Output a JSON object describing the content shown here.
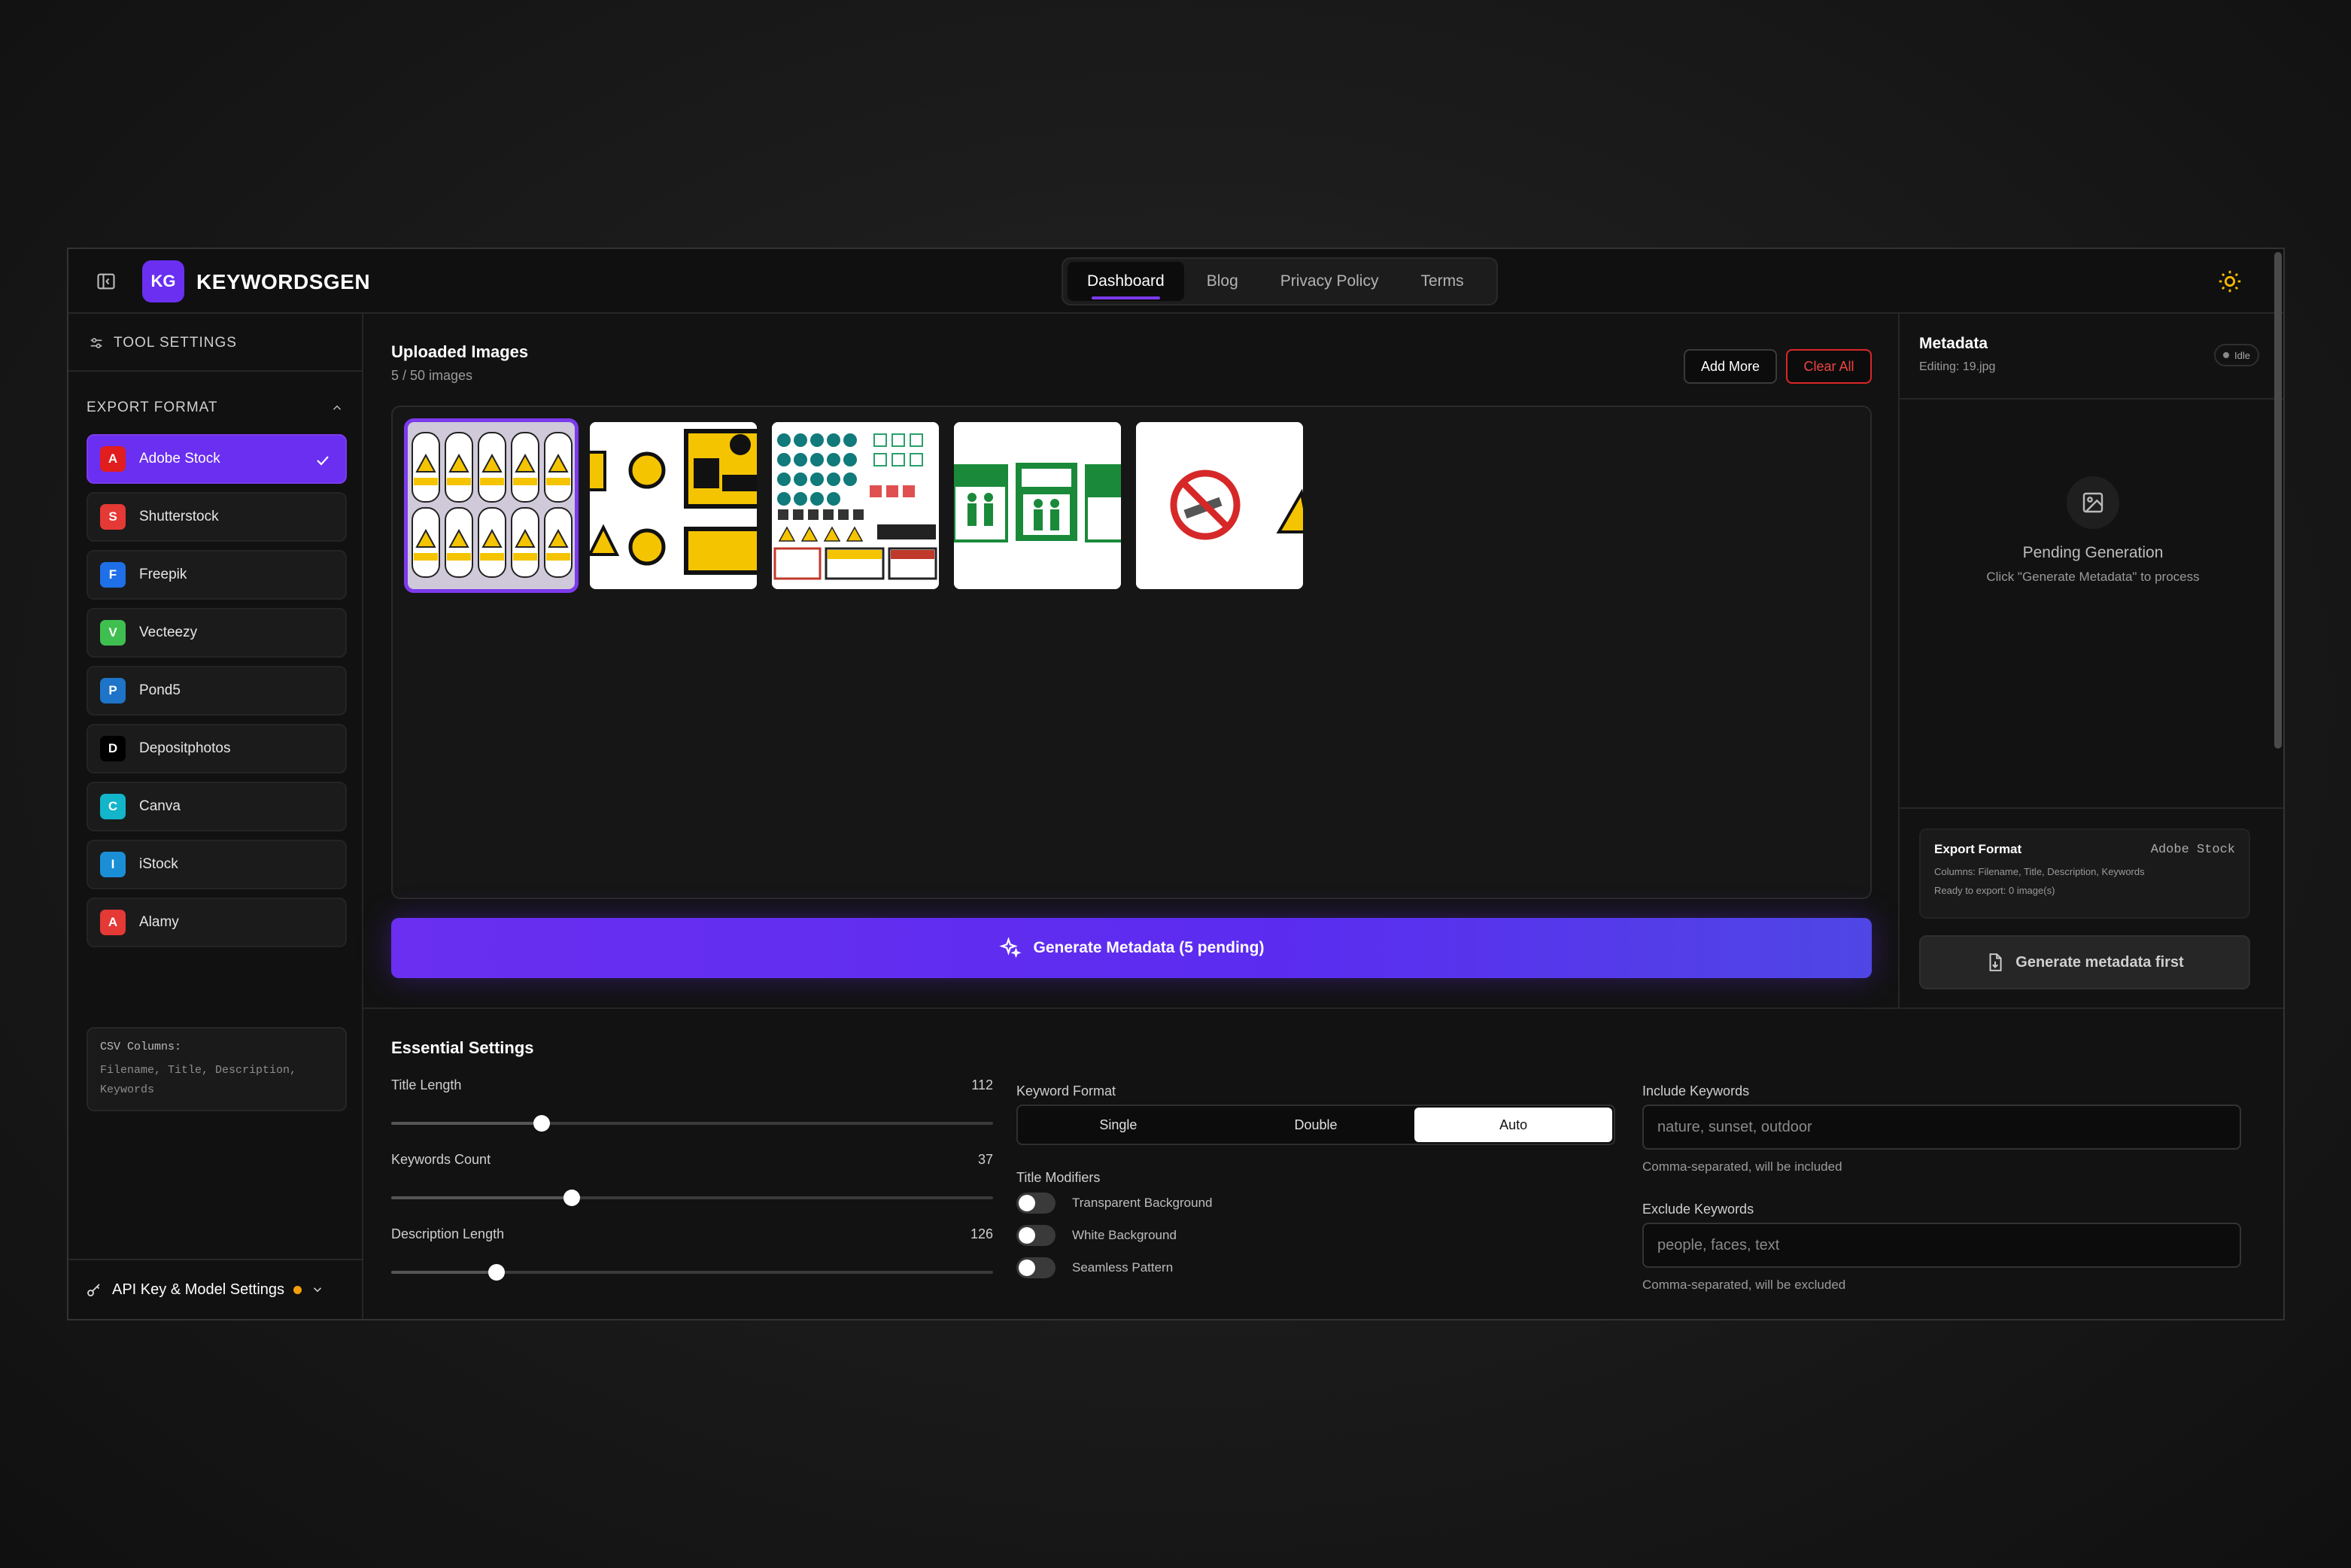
{
  "app": {
    "logo_initials": "KG",
    "logo_text": "KEYWORDSGEN"
  },
  "nav": {
    "tabs": [
      "Dashboard",
      "Blog",
      "Privacy Policy",
      "Terms"
    ],
    "active": "Dashboard"
  },
  "sidebar": {
    "title": "TOOL SETTINGS",
    "export_format_label": "EXPORT FORMAT",
    "platforms": [
      {
        "letter": "A",
        "label": "Adobe Stock",
        "color": "#e11d1d",
        "active": true
      },
      {
        "letter": "S",
        "label": "Shutterstock",
        "color": "#e53935"
      },
      {
        "letter": "F",
        "label": "Freepik",
        "color": "#1e6fe8"
      },
      {
        "letter": "V",
        "label": "Vecteezy",
        "color": "#3fbf4f"
      },
      {
        "letter": "P",
        "label": "Pond5",
        "color": "#1e74c8"
      },
      {
        "letter": "D",
        "label": "Depositphotos",
        "color": "#000000"
      },
      {
        "letter": "C",
        "label": "Canva",
        "color": "#12b5c9"
      },
      {
        "letter": "I",
        "label": "iStock",
        "color": "#1a8fd6"
      },
      {
        "letter": "A",
        "label": "Alamy",
        "color": "#e53935"
      }
    ],
    "csv_title": "CSV Columns:",
    "csv_columns": "Filename, Title, Description, Keywords",
    "api_label": "API Key & Model Settings"
  },
  "upload": {
    "title": "Uploaded Images",
    "count": "5 / 50 images",
    "add_more": "Add More",
    "clear_all": "Clear All"
  },
  "generate_button": "Generate Metadata (5 pending)",
  "metadata_panel": {
    "title": "Metadata",
    "editing": "Editing: 19.jpg",
    "status": "Idle",
    "pending_title": "Pending Generation",
    "pending_sub": "Click \"Generate Metadata\" to process",
    "export_title": "Export Format",
    "export_value": "Adobe Stock",
    "export_columns": "Columns: Filename, Title, Description, Keywords",
    "export_ready": "Ready to export: 0 image(s)",
    "generate_first": "Generate metadata first"
  },
  "settings": {
    "title": "Essential Settings",
    "sliders": [
      {
        "label": "Title Length",
        "value": "112",
        "fraction": 0.25
      },
      {
        "label": "Keywords Count",
        "value": "37",
        "fraction": 0.3
      },
      {
        "label": "Description Length",
        "value": "126",
        "fraction": 0.175
      }
    ],
    "keyword_format_label": "Keyword Format",
    "keyword_formats": [
      "Single",
      "Double",
      "Auto"
    ],
    "keyword_format_active": "Auto",
    "title_modifiers_label": "Title Modifiers",
    "modifiers": [
      "Transparent Background",
      "White Background",
      "Seamless Pattern"
    ],
    "include_label": "Include Keywords",
    "include_placeholder": "nature, sunset, outdoor",
    "include_help": "Comma-separated, will be included",
    "exclude_label": "Exclude Keywords",
    "exclude_placeholder": "people, faces, text",
    "exclude_help": "Comma-separated, will be excluded"
  }
}
